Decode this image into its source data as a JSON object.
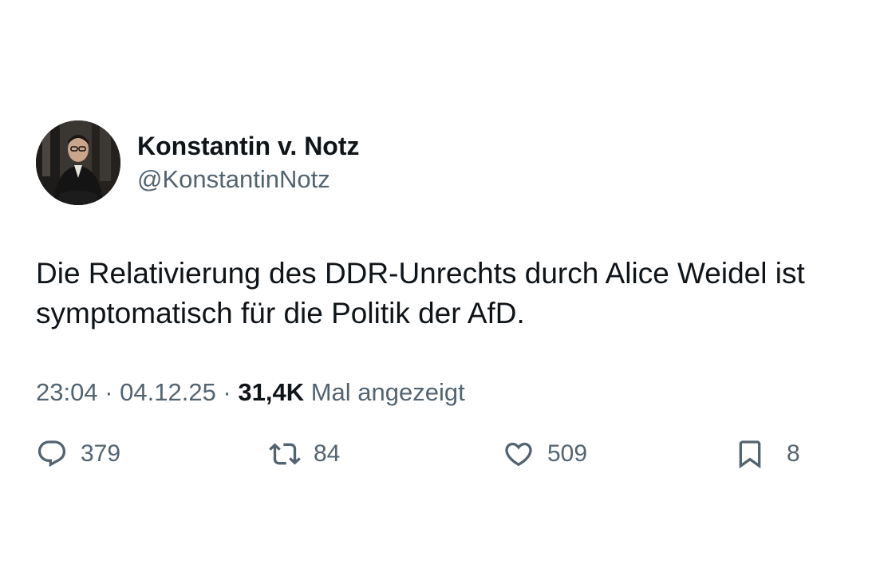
{
  "author": {
    "display_name": "Konstantin v. Notz",
    "handle": "@KonstantinNotz"
  },
  "tweet": {
    "text": "Die Relativierung des DDR-Unrechts durch Alice Weidel ist symptomatisch für die Politik der AfD."
  },
  "meta": {
    "time": "23:04",
    "separator_1": " · ",
    "date": "04.12.25",
    "separator_2": " · ",
    "views_count": "31,4K",
    "views_label": " Mal angezeigt"
  },
  "actions": {
    "reply_count": "379",
    "retweet_count": "84",
    "like_count": "509",
    "bookmark_count": "8"
  },
  "colors": {
    "primary_text": "#0f1419",
    "secondary_text": "#536471",
    "background": "#ffffff"
  },
  "icons": {
    "reply": "reply-icon",
    "retweet": "retweet-icon",
    "like": "heart-icon",
    "bookmark": "bookmark-icon"
  }
}
